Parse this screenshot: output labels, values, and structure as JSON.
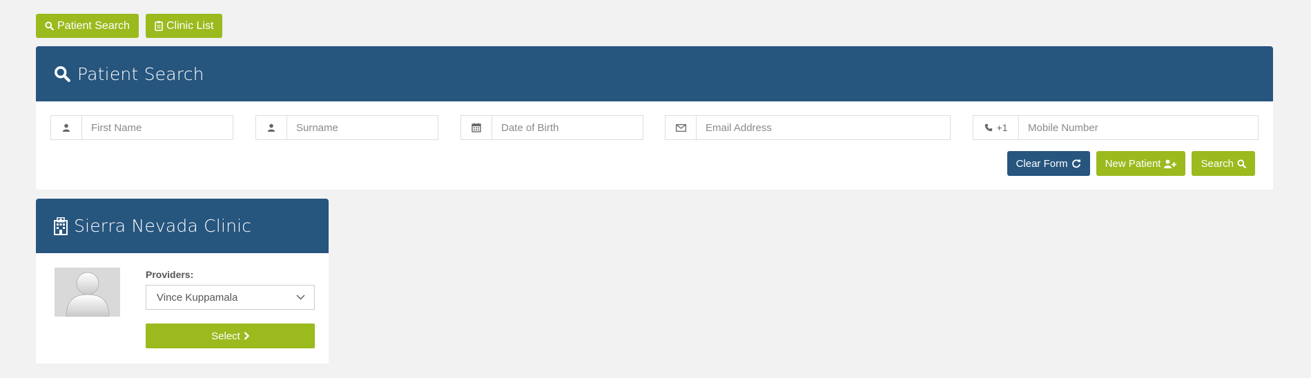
{
  "nav": {
    "patient_search_label": "Patient Search",
    "clinic_list_label": "Clinic List"
  },
  "search_panel": {
    "title": "Patient Search",
    "fields": {
      "first_name_placeholder": "First Name",
      "surname_placeholder": "Surname",
      "dob_placeholder": "Date of Birth",
      "email_placeholder": "Email Address",
      "phone_prefix": "+1",
      "mobile_placeholder": "Mobile Number"
    },
    "actions": {
      "clear_label": "Clear Form",
      "new_patient_label": "New Patient",
      "search_label": "Search"
    }
  },
  "clinic_panel": {
    "title": "Sierra Nevada Clinic",
    "providers_label": "Providers:",
    "selected_provider": "Vince Kuppamala",
    "select_label": "Select"
  },
  "colors": {
    "primary_blue": "#26557e",
    "accent_green": "#9bba1e",
    "page_background": "#f2f2f2"
  },
  "icons": [
    "search-icon",
    "clipboard-icon",
    "user-icon",
    "calendar-icon",
    "envelope-icon",
    "phone-icon",
    "refresh-icon",
    "user-plus-icon",
    "hospital-icon",
    "chevron-down-icon",
    "chevron-right-icon",
    "avatar-placeholder-icon"
  ]
}
